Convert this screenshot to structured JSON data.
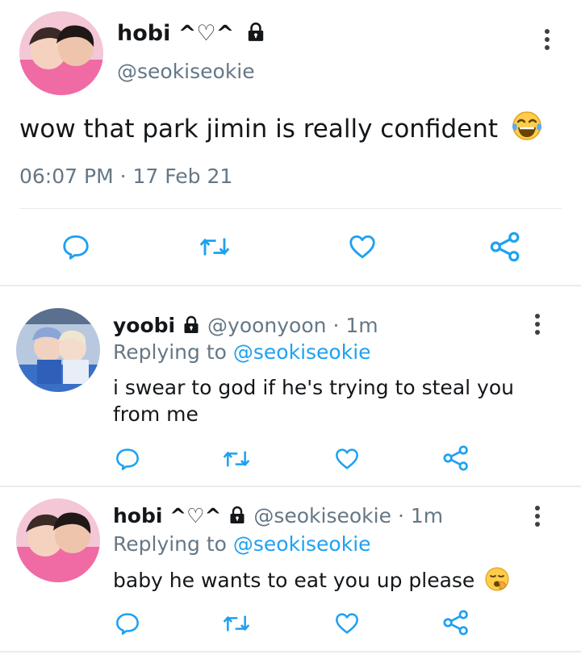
{
  "main_tweet": {
    "display_name": "hobi ^♡^",
    "handle": "@seokiseokie",
    "text": "wow that park jimin is really confident",
    "emoji": "face-with-tears-of-joy",
    "timestamp": "06:07 PM · 17 Feb 21"
  },
  "replies": [
    {
      "display_name": "yoobi",
      "handle": "@yoonyoon",
      "time": "· 1m",
      "replying_label": "Replying to",
      "replying_to": "@seokiseokie",
      "text": "i swear to god if he's trying to steal you from me"
    },
    {
      "display_name": "hobi ^♡^",
      "handle": "@seokiseokie",
      "time": "· 1m",
      "replying_label": "Replying to",
      "replying_to": "@seokiseokie",
      "text": "baby he wants to eat you up please",
      "emoji": "yawning-face"
    }
  ],
  "icons": {
    "reply": "reply-icon",
    "retweet": "retweet-icon",
    "like": "heart-icon",
    "share": "share-icon",
    "lock": "lock-icon",
    "more": "more-options-icon"
  },
  "colors": {
    "icon": "#1da1f2",
    "link": "#1da1f2",
    "muted": "#657786",
    "divider": "#e6ecf0"
  }
}
